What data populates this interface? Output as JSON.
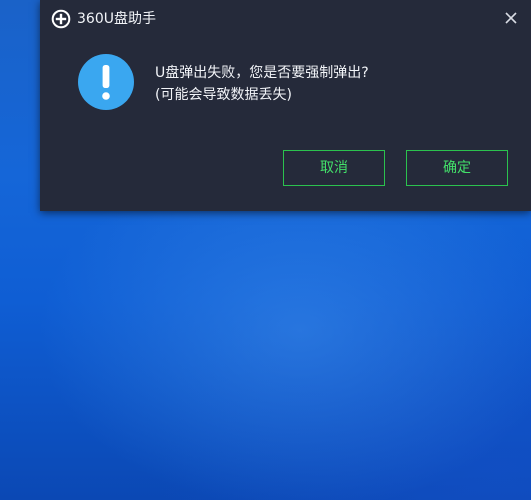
{
  "dialog": {
    "app_title": "360U盘助手",
    "logo_icon": "plus-circle-icon",
    "close_icon": "close-icon",
    "warning_icon": "exclamation-circle-icon",
    "message_line1": "U盘弹出失败，您是否要强制弹出?",
    "message_line2": "(可能会导致数据丢失)",
    "cancel_label": "取消",
    "ok_label": "确定"
  },
  "colors": {
    "dialog_bg": "#252a3a",
    "accent_green": "#2bc24e",
    "warning_blue": "#3aa7f0",
    "desktop_blue": "#1566d8"
  }
}
